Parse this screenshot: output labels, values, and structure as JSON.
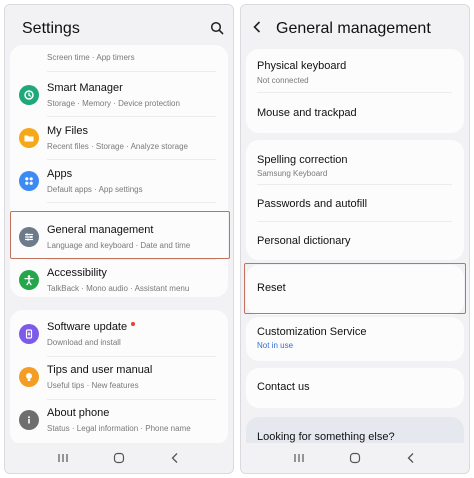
{
  "left": {
    "title": "Settings",
    "top_partial": "Screen time  ·  App timers",
    "items": [
      {
        "title": "Smart Manager",
        "subtitle": "Storage  ·  Memory  ·  Device protection",
        "icon": "smart-manager-icon",
        "color": "#1fa87a"
      },
      {
        "title": "My Files",
        "subtitle": "Recent files  ·  Storage  ·  Analyze storage",
        "icon": "folder-icon",
        "color": "#f5a818"
      },
      {
        "title": "Apps",
        "subtitle": "Default apps  ·  App settings",
        "icon": "apps-icon",
        "color": "#3c8af3"
      },
      {
        "title": "General management",
        "subtitle": "Language and keyboard  ·  Date and time",
        "icon": "sliders-icon",
        "color": "#6c7a89"
      },
      {
        "title": "Accessibility",
        "subtitle": "TalkBack  ·  Mono audio  ·  Assistant menu",
        "icon": "accessibility-icon",
        "color": "#24a64c"
      },
      {
        "title": "Software update",
        "subtitle": "Download and install",
        "icon": "software-update-icon",
        "color": "#7c5be8"
      },
      {
        "title": "Tips and user manual",
        "subtitle": "Useful tips  ·  New features",
        "icon": "tips-icon",
        "color": "#f39d25"
      },
      {
        "title": "About phone",
        "subtitle": "Status  ·  Legal information  ·  Phone name",
        "icon": "info-icon",
        "color": "#6e6e6e"
      }
    ]
  },
  "right": {
    "title": "General management",
    "items": [
      {
        "title": "Physical keyboard",
        "subtitle": "Not connected"
      },
      {
        "title": "Mouse and trackpad"
      },
      {
        "title": "Spelling correction",
        "subtitle": "Samsung Keyboard"
      },
      {
        "title": "Passwords and autofill"
      },
      {
        "title": "Personal dictionary"
      },
      {
        "title": "Reset"
      },
      {
        "title": "Customization Service",
        "subtitle": "Not in use",
        "subtitle_color": "#2f6fd8"
      },
      {
        "title": "Contact us"
      },
      {
        "title": "Looking for something else?"
      }
    ]
  },
  "colors": {
    "highlight": "#c0725e",
    "link": "#2f6fd8",
    "badge": "#e8402b"
  }
}
